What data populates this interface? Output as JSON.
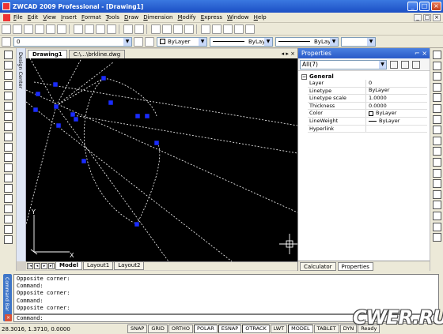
{
  "window": {
    "title": "ZWCAD 2009 Professional - [Drawing1]",
    "min": "_",
    "max": "□",
    "close": "×"
  },
  "menu": [
    "File",
    "Edit",
    "View",
    "Insert",
    "Format",
    "Tools",
    "Draw",
    "Dimension",
    "Modify",
    "Express",
    "Window",
    "Help"
  ],
  "layer_toolbar": {
    "layer_value": "0",
    "color_value": "ByLayer",
    "linetype_value": "ByLayer",
    "lineweight_value": "ByLayer"
  },
  "document_tabs": [
    {
      "label": "Drawing1",
      "active": true
    },
    {
      "label": "C:\\...\\brkline.dwg",
      "active": false
    }
  ],
  "tab_controls": "◂ ▸ ×",
  "layout_tabs": [
    {
      "label": "Model",
      "active": true
    },
    {
      "label": "Layout1",
      "active": false
    },
    {
      "label": "Layout2",
      "active": false
    }
  ],
  "design_center_label": "Design Center",
  "ucs": {
    "x_label": "X",
    "y_label": "Y"
  },
  "properties": {
    "title": "Properties",
    "header_buttons": "⌐ ×",
    "selection": "All(7)",
    "section": "General",
    "section_toggle": "−",
    "rows": [
      {
        "name": "Layer",
        "value": "0",
        "kind": "text"
      },
      {
        "name": "Linetype",
        "value": "ByLayer",
        "kind": "text"
      },
      {
        "name": "Linetype scale",
        "value": "1.0000",
        "kind": "text"
      },
      {
        "name": "Thickness",
        "value": "0.0000",
        "kind": "text"
      },
      {
        "name": "Color",
        "value": "ByLayer",
        "kind": "color"
      },
      {
        "name": "LineWeight",
        "value": "ByLayer",
        "kind": "line"
      },
      {
        "name": "Hyperlink",
        "value": "",
        "kind": "text"
      }
    ],
    "tabs": [
      {
        "label": "Calculator",
        "active": false
      },
      {
        "label": "Properties",
        "active": true
      }
    ]
  },
  "command": {
    "sidebar_label": "Command Bar",
    "history": [
      "Opposite corner:",
      "Command:",
      "Opposite corner:",
      "Command:",
      "Opposite corner:"
    ],
    "prompt": "Command:",
    "close_glyph": "×"
  },
  "status": {
    "coords": "28.3016, 1.3710, 0.0000",
    "buttons": [
      {
        "label": "SNAP",
        "on": false
      },
      {
        "label": "GRID",
        "on": false
      },
      {
        "label": "ORTHO",
        "on": false
      },
      {
        "label": "POLAR",
        "on": true
      },
      {
        "label": "ESNAP",
        "on": true
      },
      {
        "label": "OTRACK",
        "on": true
      },
      {
        "label": "LWT",
        "on": false
      },
      {
        "label": "MODEL",
        "on": true
      },
      {
        "label": "TABLET",
        "on": false
      },
      {
        "label": "DYN",
        "on": false
      },
      {
        "label": "Ready",
        "on": false
      }
    ]
  },
  "watermark": "CWER.RU",
  "colors": {
    "grip": "#1a2cff",
    "canvas": "#000000",
    "dashed_line": "#ffffff",
    "title_bar": "#2a60d8"
  }
}
